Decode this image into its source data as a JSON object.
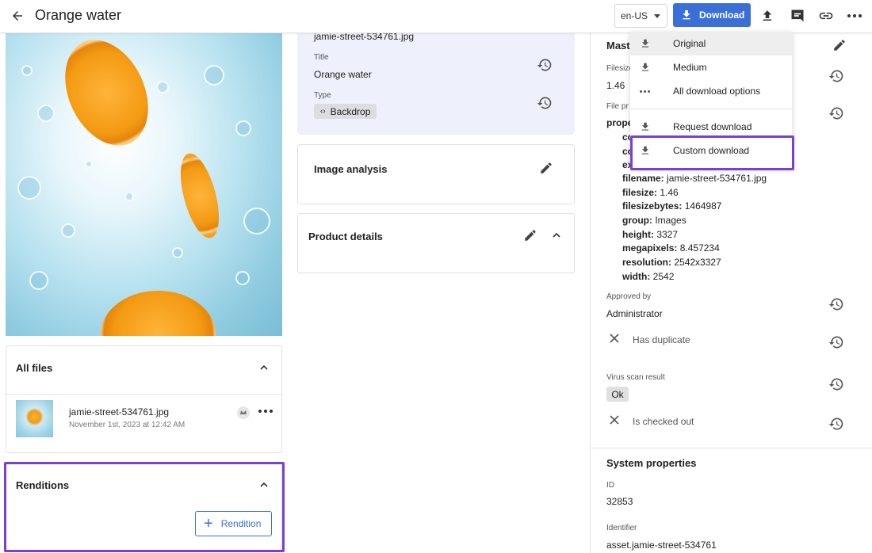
{
  "header": {
    "title": "Orange water",
    "language": "en-US",
    "download_label": "Download"
  },
  "left": {
    "all_files_title": "All files",
    "file": {
      "name": "jamie-street-534761.jpg",
      "date": "November 1st, 2023 at 12:42 AM"
    },
    "renditions_title": "Renditions",
    "rendition_button": "Rendition"
  },
  "middle": {
    "filename": "jamie-street-534761.jpg",
    "title_label": "Title",
    "title_value": "Orange water",
    "type_label": "Type",
    "type_value": "Backdrop",
    "image_analysis_title": "Image analysis",
    "product_details_title": "Product details"
  },
  "right": {
    "master_partial": "Mast",
    "filesize_label_partial": "Filesize",
    "filesize_value_partial": "1.46",
    "file_props_label_partial": "File pr",
    "props_partial": "prope",
    "props_c1": "co",
    "props_c2": "co",
    "props_e": "ex",
    "properties": [
      {
        "key": "filename:",
        "value": "jamie-street-534761.jpg"
      },
      {
        "key": "filesize:",
        "value": "1.46"
      },
      {
        "key": "filesizebytes:",
        "value": "1464987"
      },
      {
        "key": "group:",
        "value": "Images"
      },
      {
        "key": "height:",
        "value": "3327"
      },
      {
        "key": "megapixels:",
        "value": "8.457234"
      },
      {
        "key": "resolution:",
        "value": "2542x3327"
      },
      {
        "key": "width:",
        "value": "2542"
      }
    ],
    "approved_by_label": "Approved by",
    "approved_by_value": "Administrator",
    "has_duplicate": "Has duplicate",
    "virus_scan_label": "Virus scan result",
    "virus_scan_value": "Ok",
    "checked_out": "Is checked out",
    "system_properties_title": "System properties",
    "id_label": "ID",
    "id_value": "32853",
    "identifier_label": "Identifier",
    "identifier_value": "asset.jamie-street-534761"
  },
  "download_menu": {
    "items": [
      {
        "label": "Original",
        "icon": "download-icon"
      },
      {
        "label": "Medium",
        "icon": "download-icon"
      },
      {
        "label": "All download options",
        "icon": "more-horizontal-icon"
      },
      {
        "label": "Request download",
        "icon": "download-icon"
      },
      {
        "label": "Custom download",
        "icon": "download-icon"
      }
    ]
  },
  "colors": {
    "accent": "#3b6fd8",
    "highlight": "#7a3fd6",
    "meta_card_bg": "#eef0fb"
  }
}
